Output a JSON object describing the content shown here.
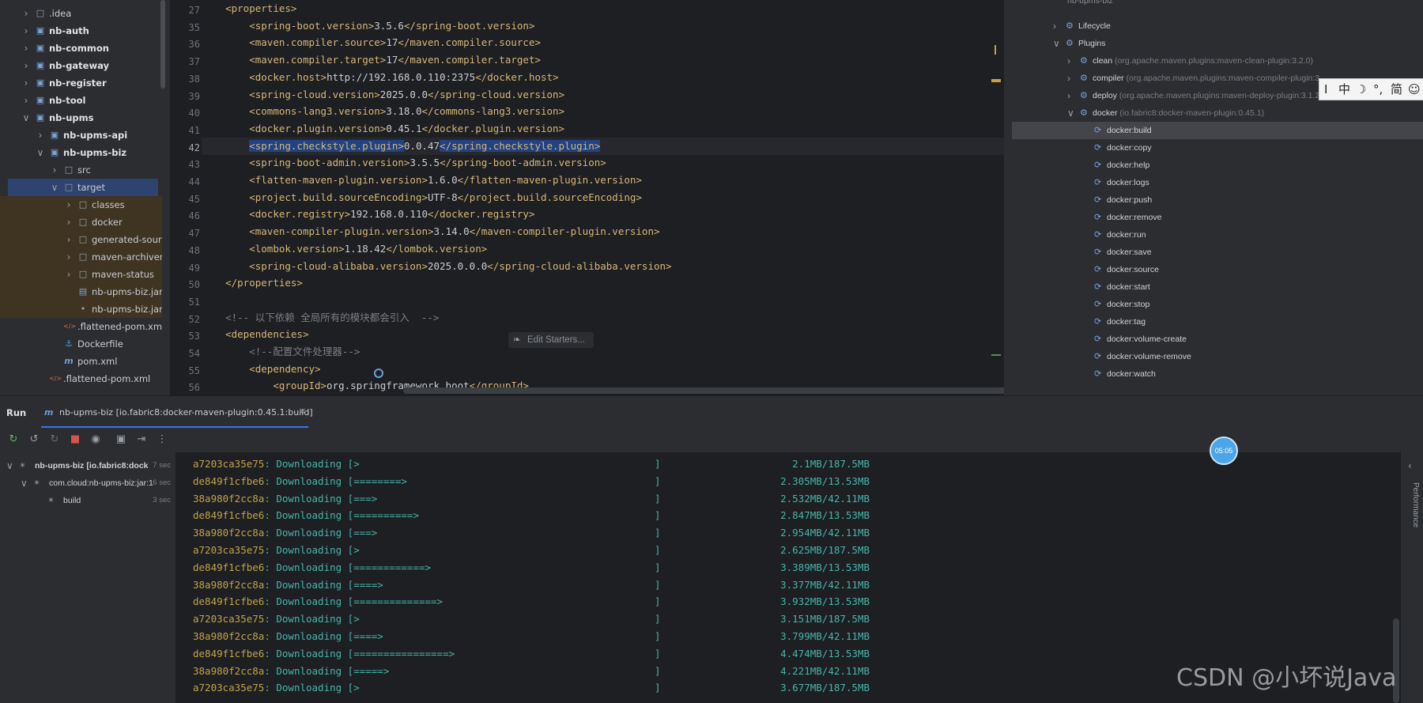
{
  "project_tree": {
    "items": [
      {
        "label": ".idea",
        "bold": false,
        "icon": "folder-icon"
      },
      {
        "label": "nb-auth",
        "bold": true,
        "icon": "module-icon"
      },
      {
        "label": "nb-common",
        "bold": true,
        "icon": "module-icon"
      },
      {
        "label": "nb-gateway",
        "bold": true,
        "icon": "module-icon"
      },
      {
        "label": "nb-register",
        "bold": true,
        "icon": "module-icon"
      },
      {
        "label": "nb-tool",
        "bold": true,
        "icon": "module-icon"
      },
      {
        "label": "nb-upms",
        "bold": true,
        "icon": "module-icon"
      },
      {
        "label": "nb-upms-api",
        "bold": true,
        "icon": "module-icon"
      },
      {
        "label": "nb-upms-biz",
        "bold": true,
        "icon": "module-icon"
      },
      {
        "label": "src",
        "bold": false,
        "icon": "folder-icon"
      },
      {
        "label": "target",
        "bold": false,
        "icon": "folder-icon"
      },
      {
        "label": "classes",
        "bold": false,
        "icon": "folder-icon"
      },
      {
        "label": "docker",
        "bold": false,
        "icon": "folder-icon"
      },
      {
        "label": "generated-sources",
        "bold": false,
        "icon": "folder-icon"
      },
      {
        "label": "maven-archiver",
        "bold": false,
        "icon": "folder-icon"
      },
      {
        "label": "maven-status",
        "bold": false,
        "icon": "folder-icon"
      },
      {
        "label": "nb-upms-biz.jar",
        "bold": false,
        "icon": "jar-icon"
      },
      {
        "label": "nb-upms-biz.jar.original",
        "bold": false,
        "icon": "file-icon"
      },
      {
        "label": ".flattened-pom.xml",
        "bold": false,
        "icon": "xml-icon"
      },
      {
        "label": "Dockerfile",
        "bold": false,
        "icon": "docker-icon"
      },
      {
        "label": "pom.xml",
        "bold": false,
        "icon": "maven-icon"
      },
      {
        "label": ".flattened-pom.xml",
        "bold": false,
        "icon": "xml-icon"
      }
    ]
  },
  "editor": {
    "line_numbers": [
      "27",
      "35",
      "36",
      "37",
      "38",
      "39",
      "40",
      "41",
      "42",
      "43",
      "44",
      "45",
      "46",
      "47",
      "48",
      "49",
      "50",
      "51",
      "52",
      "53",
      "54",
      "55",
      "56"
    ],
    "lines": [
      {
        "tag_open": "<properties>",
        "text": "",
        "tag_close": ""
      },
      {
        "tag_open": "<spring-boot.version>",
        "text": "3.5.6",
        "tag_close": "</spring-boot.version>"
      },
      {
        "tag_open": "<maven.compiler.source>",
        "text": "17",
        "tag_close": "</maven.compiler.source>"
      },
      {
        "tag_open": "<maven.compiler.target>",
        "text": "17",
        "tag_close": "</maven.compiler.target>"
      },
      {
        "tag_open": "<docker.host>",
        "text": "http://192.168.0.110:2375",
        "tag_close": "</docker.host>"
      },
      {
        "tag_open": "<spring-cloud.version>",
        "text": "2025.0.0",
        "tag_close": "</spring-cloud.version>"
      },
      {
        "tag_open": "<commons-lang3.version>",
        "text": "3.18.0",
        "tag_close": "</commons-lang3.version>"
      },
      {
        "tag_open": "<docker.plugin.version>",
        "text": "0.45.1",
        "tag_close": "</docker.plugin.version>"
      },
      {
        "tag_open": "<spring.checkstyle.plugin>",
        "text": "0.0.47",
        "tag_close": "</spring.checkstyle.plugin>"
      },
      {
        "tag_open": "<spring-boot-admin.version>",
        "text": "3.5.5",
        "tag_close": "</spring-boot-admin.version>"
      },
      {
        "tag_open": "<flatten-maven-plugin.version>",
        "text": "1.6.0",
        "tag_close": "</flatten-maven-plugin.version>"
      },
      {
        "tag_open": "<project.build.sourceEncoding>",
        "text": "UTF-8",
        "tag_close": "</project.build.sourceEncoding>"
      },
      {
        "tag_open": "<docker.registry>",
        "text": "192.168.0.110",
        "tag_close": "</docker.registry>"
      },
      {
        "tag_open": "<maven-compiler-plugin.version>",
        "text": "3.14.0",
        "tag_close": "</maven-compiler-plugin.version>"
      },
      {
        "tag_open": "<lombok.version>",
        "text": "1.18.42",
        "tag_close": "</lombok.version>"
      },
      {
        "tag_open": "<spring-cloud-alibaba.version>",
        "text": "2025.0.0.0",
        "tag_close": "</spring-cloud-alibaba.version>"
      },
      {
        "tag_open": "</properties>",
        "text": "",
        "tag_close": ""
      },
      {
        "tag_open": "",
        "text": "",
        "tag_close": ""
      },
      {
        "comment": "<!-- 以下依赖 全局所有的模块都会引入  -->"
      },
      {
        "tag_open": "<dependencies>",
        "text": "",
        "tag_close": ""
      },
      {
        "comment": "<!--配置文件处理器-->"
      },
      {
        "tag_open": "<dependency>",
        "text": "",
        "tag_close": ""
      },
      {
        "tag_open": "<groupId>",
        "text": "org.springframework.boot",
        "tag_close": "</groupId>"
      }
    ],
    "edit_starters": "Edit Starters..."
  },
  "maven": {
    "top_label": "nb-upms-biz",
    "lifecycle": "Lifecycle",
    "plugins": "Plugins",
    "plugin_list": [
      {
        "name": "clean",
        "coord": "(org.apache.maven.plugins:maven-clean-plugin:3.2.0)"
      },
      {
        "name": "compiler",
        "coord": "(org.apache.maven.plugins:maven-compiler-plugin:3..."
      },
      {
        "name": "deploy",
        "coord": "(org.apache.maven.plugins:maven-deploy-plugin:3.1.2"
      },
      {
        "name": "docker",
        "coord": "(io.fabric8:docker-maven-plugin:0.45.1)"
      }
    ],
    "goals": [
      "docker:build",
      "docker:copy",
      "docker:help",
      "docker:logs",
      "docker:push",
      "docker:remove",
      "docker:run",
      "docker:save",
      "docker:source",
      "docker:start",
      "docker:stop",
      "docker:tag",
      "docker:volume-create",
      "docker:volume-remove",
      "docker:watch"
    ]
  },
  "ime": {
    "items": [
      "I",
      "中",
      "☽",
      "°,",
      "简",
      "☺"
    ]
  },
  "run": {
    "title": "Run",
    "tab_label": "nb-upms-biz [io.fabric8:docker-maven-plugin:0.45.1:build]",
    "tree": [
      {
        "label": "nb-upms-biz [io.fabric8:dock",
        "time": "7 sec"
      },
      {
        "label": "com.cloud:nb-upms-biz:jar:1",
        "time": "6 sec"
      },
      {
        "label": "build",
        "time": "3 sec"
      }
    ],
    "timer": "05:05",
    "console": [
      {
        "id": "a7203ca35e75",
        "bar": "[>",
        "size": "2.1MB/187.5MB"
      },
      {
        "id": "de849f1cfbe6",
        "bar": "[========>",
        "size": "2.305MB/13.53MB"
      },
      {
        "id": "38a980f2cc8a",
        "bar": "[===>",
        "size": "2.532MB/42.11MB"
      },
      {
        "id": "de849f1cfbe6",
        "bar": "[==========>",
        "size": "2.847MB/13.53MB"
      },
      {
        "id": "38a980f2cc8a",
        "bar": "[===>",
        "size": "2.954MB/42.11MB"
      },
      {
        "id": "a7203ca35e75",
        "bar": "[>",
        "size": "2.625MB/187.5MB"
      },
      {
        "id": "de849f1cfbe6",
        "bar": "[============>",
        "size": "3.389MB/13.53MB"
      },
      {
        "id": "38a980f2cc8a",
        "bar": "[====>",
        "size": "3.377MB/42.11MB"
      },
      {
        "id": "de849f1cfbe6",
        "bar": "[==============>",
        "size": "3.932MB/13.53MB"
      },
      {
        "id": "a7203ca35e75",
        "bar": "[>",
        "size": "3.151MB/187.5MB"
      },
      {
        "id": "38a980f2cc8a",
        "bar": "[====>",
        "size": "3.799MB/42.11MB"
      },
      {
        "id": "de849f1cfbe6",
        "bar": "[================>",
        "size": "4.474MB/13.53MB"
      },
      {
        "id": "38a980f2cc8a",
        "bar": "[=====>",
        "size": "4.221MB/42.11MB"
      },
      {
        "id": "a7203ca35e75",
        "bar": "[>",
        "size": "3.677MB/187.5MB"
      }
    ],
    "downloading": "Downloading",
    "close_bracket": "]",
    "performance": "Performance"
  },
  "watermark": "CSDN @小坏说Java"
}
